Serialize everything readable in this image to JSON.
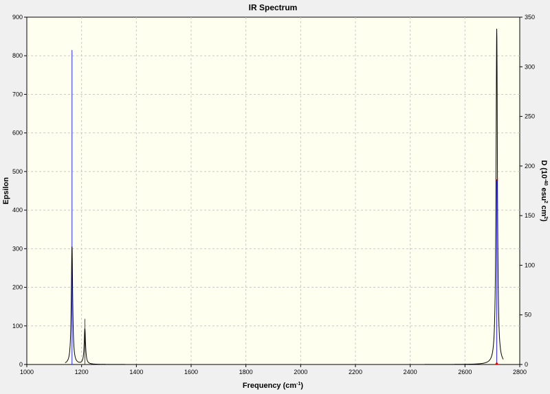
{
  "chart_data": {
    "type": "line",
    "title": "IR Spectrum",
    "xlabel": {
      "base": "Frequency (cm",
      "sup": "-1",
      "tail": ")"
    },
    "ylabel_left": "Epsilon",
    "ylabel_right": {
      "p1": "D (10",
      "s1": "-40",
      "p2": " esu",
      "s2": "2",
      "p3": " cm",
      "s3": "2",
      "p4": ")"
    },
    "xlim": [
      1000,
      2800
    ],
    "x_ticks": [
      1000,
      1200,
      1400,
      1600,
      1800,
      2000,
      2200,
      2400,
      2600,
      2800
    ],
    "ylim_left": [
      0,
      900
    ],
    "y_left_ticks": [
      0,
      100,
      200,
      300,
      400,
      500,
      600,
      700,
      800,
      900
    ],
    "ylim_right": [
      0,
      350
    ],
    "y_right_ticks": [
      0,
      50,
      100,
      150,
      200,
      250,
      300,
      350
    ],
    "grid": true,
    "x_range": [
      1140,
      2740
    ],
    "peaks": [
      {
        "freq": 1165,
        "epsilon": 305,
        "D": 317
      },
      {
        "freq": 1212,
        "epsilon": 92,
        "D": 46
      },
      {
        "freq": 2716,
        "epsilon": 870,
        "D": 186
      }
    ],
    "marker": {
      "freq": 2716,
      "D": 186
    },
    "colors": {
      "spectrum": "#000000",
      "stick": "#2a2aff",
      "marker": "#e00000",
      "plot_bg": "#fffff0",
      "grid": "#c8c8c8"
    }
  }
}
